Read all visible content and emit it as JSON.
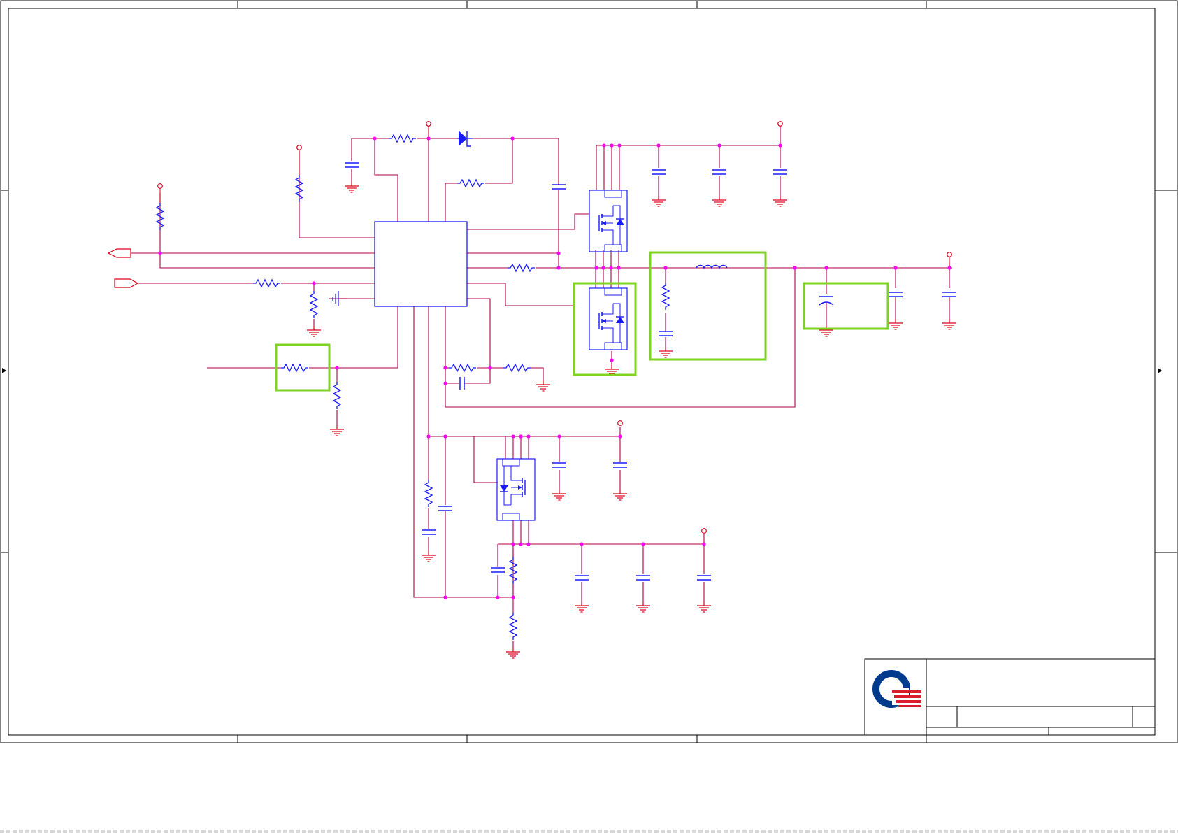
{
  "colors": {
    "wire": "#b0004a",
    "net_red": "#e0001b",
    "component": "#1a1aff",
    "junction": "#ff00ff",
    "highlight": "#7ed321",
    "frame": "#000000",
    "logo_blue": "#003a8c",
    "logo_red": "#d81e2c"
  },
  "icons": {
    "logo": "company-logo-icon",
    "ground": "ground-icon",
    "power_port": "power-port-icon",
    "resistor": "resistor-icon",
    "capacitor": "capacitor-icon",
    "inductor": "inductor-icon",
    "mosfet": "mosfet-icon",
    "diode": "diode-icon",
    "offpage_out": "offpage-output-icon",
    "offpage_in": "offpage-input-icon"
  },
  "title_block": {
    "title": "",
    "size": "",
    "document_number": "",
    "rev": "",
    "date": "",
    "sheet": ""
  }
}
